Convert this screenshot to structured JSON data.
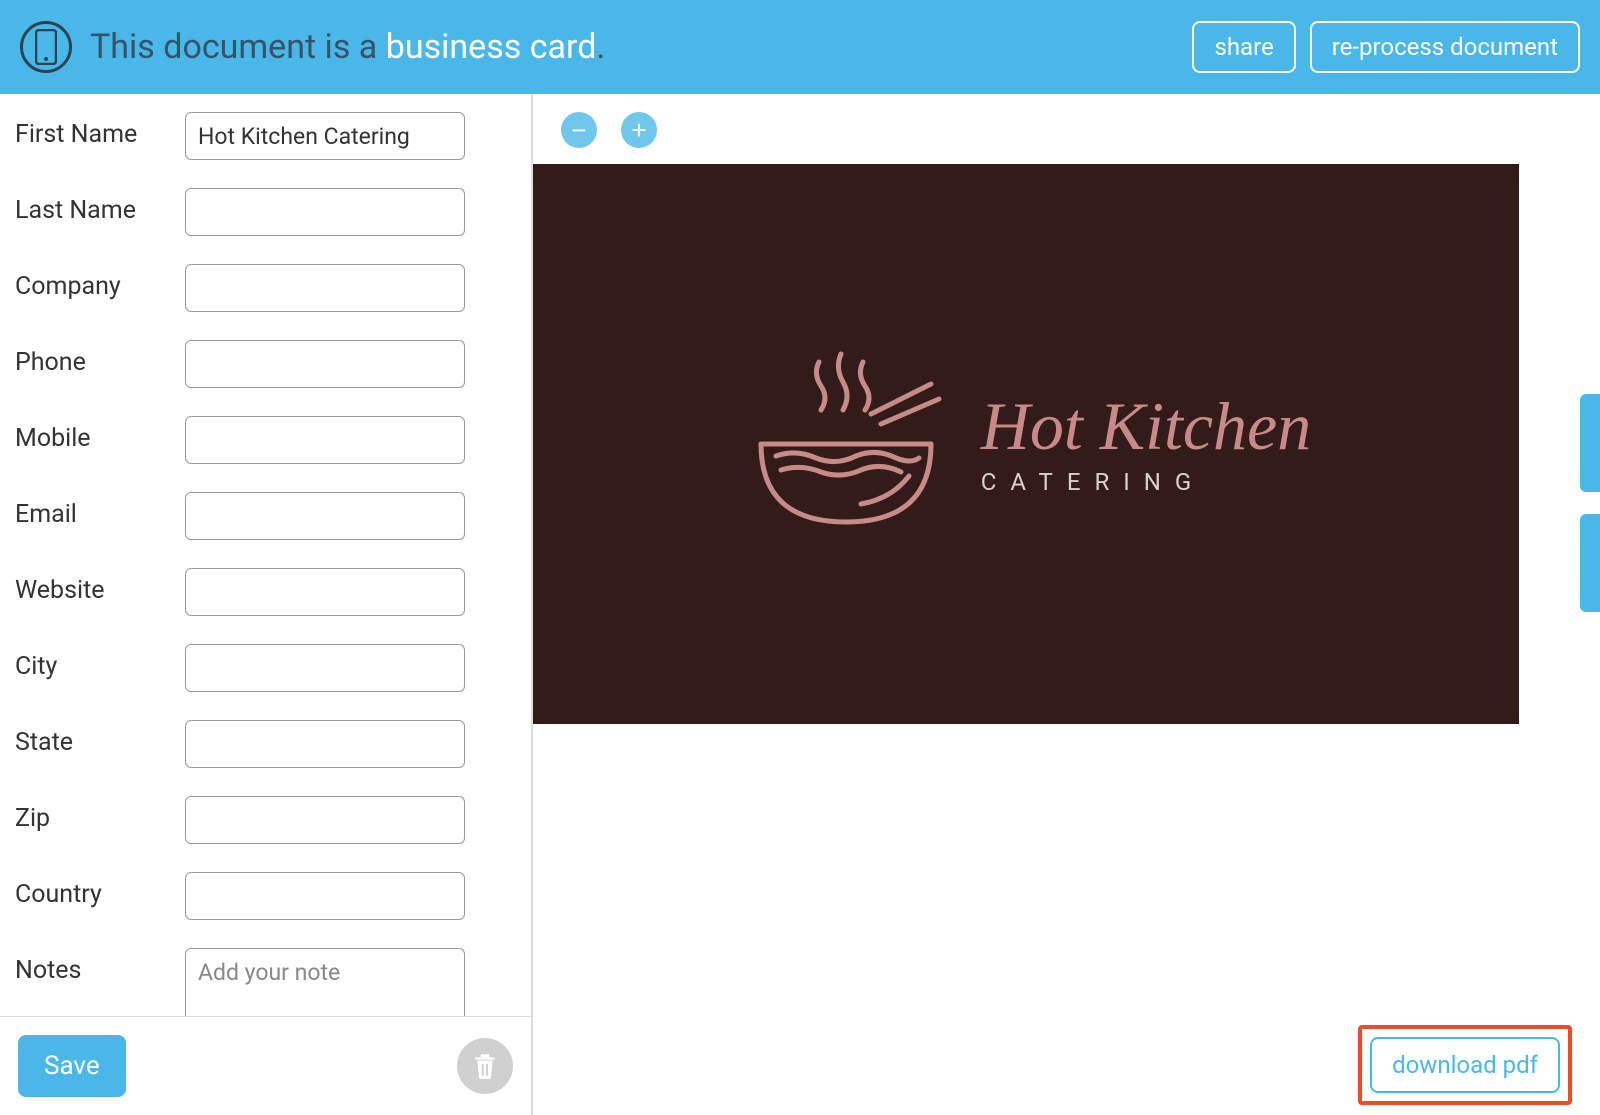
{
  "header": {
    "prefix": "This document is a ",
    "doc_type": "business card",
    "suffix": ".",
    "share_label": "share",
    "reprocess_label": "re-process document"
  },
  "form": {
    "fields": [
      {
        "label": "First Name",
        "value": "Hot Kitchen Catering",
        "type": "text"
      },
      {
        "label": "Last Name",
        "value": "",
        "type": "text"
      },
      {
        "label": "Company",
        "value": "",
        "type": "text"
      },
      {
        "label": "Phone",
        "value": "",
        "type": "text"
      },
      {
        "label": "Mobile",
        "value": "",
        "type": "text"
      },
      {
        "label": "Email",
        "value": "",
        "type": "text"
      },
      {
        "label": "Website",
        "value": "",
        "type": "text"
      },
      {
        "label": "City",
        "value": "",
        "type": "text"
      },
      {
        "label": "State",
        "value": "",
        "type": "text"
      },
      {
        "label": "Zip",
        "value": "",
        "type": "text"
      },
      {
        "label": "Country",
        "value": "",
        "type": "text"
      }
    ],
    "notes_label": "Notes",
    "notes_placeholder": "Add your note",
    "notes_value": "",
    "save_label": "Save"
  },
  "preview": {
    "zoom_out": "−",
    "zoom_in": "+",
    "card_title": "Hot Kitchen",
    "card_subtitle": "CATERING",
    "download_label": "download pdf"
  },
  "colors": {
    "theme": "#49b8e8",
    "card_bg": "#321b19",
    "card_accent": "#c78a88",
    "highlight_border": "#ee4b2b"
  }
}
